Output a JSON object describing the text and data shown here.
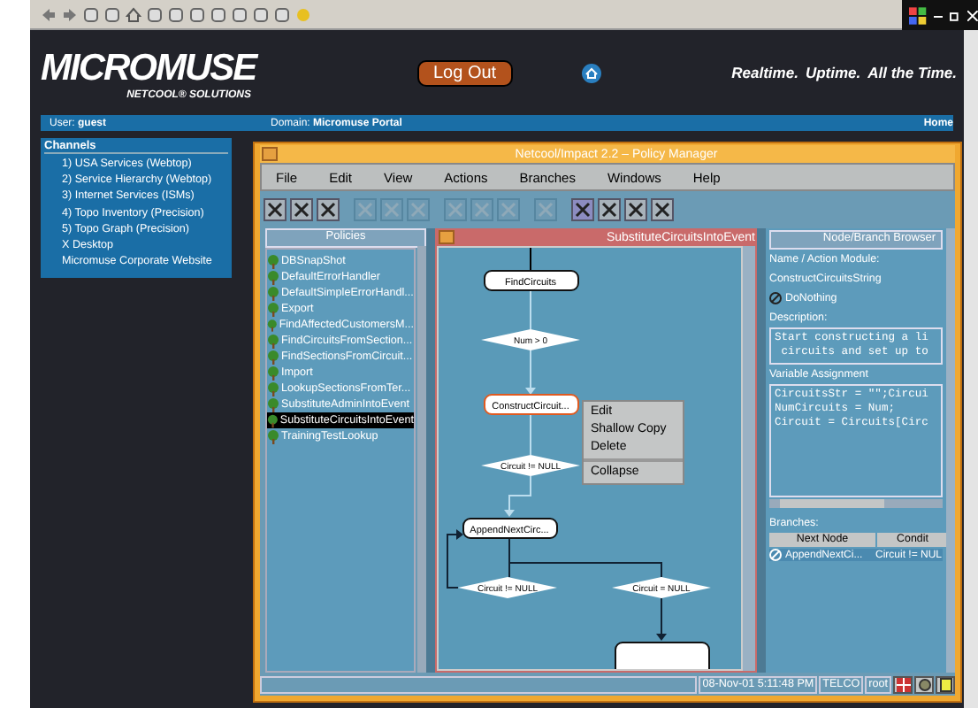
{
  "header": {
    "logo": "MICROMUSE",
    "logo_sub": "NETCOOL® SOLUTIONS",
    "logout": "Log Out",
    "tagline": [
      "Realtime.",
      "Uptime.",
      "All the Time."
    ]
  },
  "user_bar": {
    "user_label": "User:",
    "user": "guest",
    "domain_label": "Domain:",
    "domain": "Micromuse Portal",
    "home": "Home"
  },
  "channels": {
    "title": "Channels",
    "items": [
      "1) USA Services (Webtop)",
      "2) Service Hierarchy (Webtop)",
      "3) Internet Services (ISMs)",
      "4) Topo Inventory (Precision)",
      "5) Topo Graph (Precision)",
      "X Desktop",
      "Micromuse Corporate Website"
    ]
  },
  "policy_manager": {
    "title": "Netcool/Impact 2.2 – Policy Manager",
    "menu": [
      "File",
      "Edit",
      "View",
      "Actions",
      "Branches",
      "Windows",
      "Help"
    ],
    "toolbar": [
      {
        "disabled": false,
        "selected": false
      },
      {
        "disabled": false,
        "selected": false
      },
      {
        "disabled": false,
        "selected": false
      },
      {
        "disabled": true,
        "selected": false
      },
      {
        "disabled": true,
        "selected": false
      },
      {
        "disabled": true,
        "selected": false
      },
      {
        "disabled": true,
        "selected": false
      },
      {
        "disabled": true,
        "selected": false
      },
      {
        "disabled": true,
        "selected": false
      },
      {
        "disabled": true,
        "selected": false
      },
      {
        "disabled": false,
        "selected": true
      },
      {
        "disabled": false,
        "selected": false
      },
      {
        "disabled": false,
        "selected": false
      },
      {
        "disabled": false,
        "selected": false
      }
    ],
    "policies": {
      "title": "Policies",
      "items": [
        {
          "label": "DBSnapShot",
          "selected": false
        },
        {
          "label": "DefaultErrorHandler",
          "selected": false
        },
        {
          "label": "DefaultSimpleErrorHandl...",
          "selected": false
        },
        {
          "label": "Export",
          "selected": false
        },
        {
          "label": "FindAffectedCustomersM...",
          "selected": false
        },
        {
          "label": "FindCircuitsFromSection...",
          "selected": false
        },
        {
          "label": "FindSectionsFromCircuit...",
          "selected": false
        },
        {
          "label": "Import",
          "selected": false
        },
        {
          "label": "LookupSectionsFromTer...",
          "selected": false
        },
        {
          "label": "SubstituteAdminIntoEvent",
          "selected": false
        },
        {
          "label": "SubstituteCircuitsIntoEvent",
          "selected": true
        },
        {
          "label": "TrainingTestLookup",
          "selected": false
        }
      ]
    },
    "editor": {
      "title": "SubstituteCircuitsIntoEvent",
      "nodes": [
        {
          "kind": "action",
          "label": "FindCircuits",
          "selected": false
        },
        {
          "kind": "decision",
          "label": "Num > 0"
        },
        {
          "kind": "action",
          "label": "ConstructCircuit...",
          "selected": true
        },
        {
          "kind": "decision",
          "label": "Circuit != NULL"
        },
        {
          "kind": "action",
          "label": "AppendNextCirc...",
          "selected": false
        },
        {
          "kind": "decision",
          "label": "Circuit != NULL"
        },
        {
          "kind": "decision",
          "label": "Circuit = NULL"
        }
      ],
      "context_menu": [
        "Edit",
        "Shallow Copy",
        "Delete",
        "Collapse"
      ]
    },
    "node_browser": {
      "title": "Node/Branch Browser",
      "name_label": "Name / Action Module:",
      "name": "ConstructCircuitsString",
      "module": "DoNothing",
      "description_label": "Description:",
      "description": [
        "Start constructing a li",
        " circuits and set up to"
      ],
      "variable_label": "Variable Assignment",
      "variables": [
        "CircuitsStr = \"\";Circui",
        "NumCircuits = Num;",
        "Circuit = Circuits[Circ"
      ],
      "branches_label": "Branches:",
      "columns": [
        "Next Node",
        "Condit"
      ],
      "rows": [
        [
          "AppendNextCi...",
          "Circuit != NUL"
        ]
      ]
    },
    "status_bar": {
      "date": "08-Nov-01 5:11:48 PM",
      "domain": "TELCO",
      "user": "root"
    }
  }
}
